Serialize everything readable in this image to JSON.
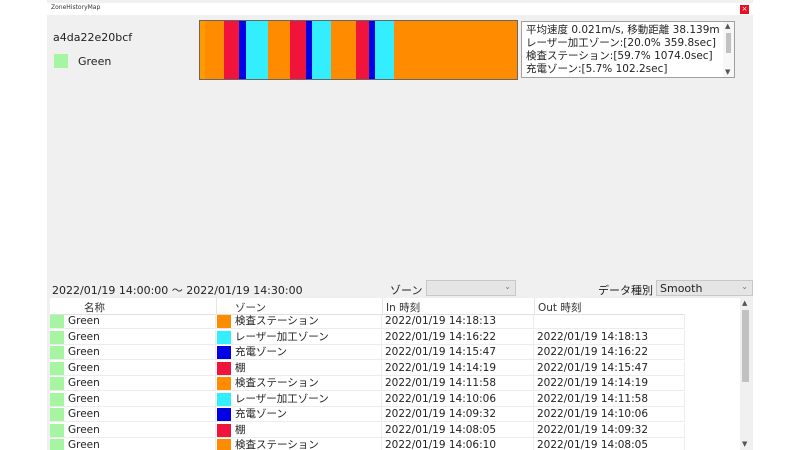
{
  "window": {
    "title": "ZoneHistoryMap",
    "close_glyph": "×"
  },
  "device": {
    "id": "a4da22e20bcf",
    "legend_label": "Green",
    "legend_color": "#a6f5a3"
  },
  "timeline": {
    "segments": [
      {
        "color": "#ff9900",
        "w": 1.5
      },
      {
        "color": "#ff8c00",
        "w": 6
      },
      {
        "color": "#f0143c",
        "w": 5
      },
      {
        "color": "#0000e6",
        "w": 2
      },
      {
        "color": "#33eeff",
        "w": 7
      },
      {
        "color": "#ff8c00",
        "w": 7
      },
      {
        "color": "#f0143c",
        "w": 5
      },
      {
        "color": "#0000e6",
        "w": 2
      },
      {
        "color": "#33eeff",
        "w": 6
      },
      {
        "color": "#ff8c00",
        "w": 8
      },
      {
        "color": "#f0143c",
        "w": 4
      },
      {
        "color": "#0000e6",
        "w": 2
      },
      {
        "color": "#33eeff",
        "w": 6
      },
      {
        "color": "#ff8c00",
        "w": 39
      }
    ]
  },
  "info": {
    "lines": [
      "平均速度 0.021m/s, 移動距離 38.139m",
      "レーザー加工ゾーン:[20.0% 359.8sec]",
      "検査ステーション:[59.7% 1074.0sec]",
      "充電ゾーン:[5.7% 102.2sec]"
    ],
    "scroll_up": "▲",
    "scroll_down": "▼"
  },
  "filter": {
    "time_range": "2022/01/19 14:00:00 ～ 2022/01/19 14:30:00",
    "zone_label": "ゾーン",
    "zone_value": "",
    "datatype_label": "データ種別",
    "datatype_value": "Smooth",
    "dropdown_glyph": "⌄"
  },
  "table": {
    "columns": [
      "名称",
      "ゾーン",
      "In 時刻",
      "Out 時刻"
    ],
    "rows": [
      {
        "name": "Green",
        "name_color": "#a6f5a3",
        "zone": "検査ステーション",
        "zone_color": "#ff8c00",
        "in": "2022/01/19 14:18:13",
        "out": ""
      },
      {
        "name": "Green",
        "name_color": "#a6f5a3",
        "zone": "レーザー加工ゾーン",
        "zone_color": "#33eeff",
        "in": "2022/01/19 14:16:22",
        "out": "2022/01/19 14:18:13"
      },
      {
        "name": "Green",
        "name_color": "#a6f5a3",
        "zone": "充電ゾーン",
        "zone_color": "#0000e6",
        "in": "2022/01/19 14:15:47",
        "out": "2022/01/19 14:16:22"
      },
      {
        "name": "Green",
        "name_color": "#a6f5a3",
        "zone": "棚",
        "zone_color": "#f0143c",
        "in": "2022/01/19 14:14:19",
        "out": "2022/01/19 14:15:47"
      },
      {
        "name": "Green",
        "name_color": "#a6f5a3",
        "zone": "検査ステーション",
        "zone_color": "#ff8c00",
        "in": "2022/01/19 14:11:58",
        "out": "2022/01/19 14:14:19"
      },
      {
        "name": "Green",
        "name_color": "#a6f5a3",
        "zone": "レーザー加工ゾーン",
        "zone_color": "#33eeff",
        "in": "2022/01/19 14:10:06",
        "out": "2022/01/19 14:11:58"
      },
      {
        "name": "Green",
        "name_color": "#a6f5a3",
        "zone": "充電ゾーン",
        "zone_color": "#0000e6",
        "in": "2022/01/19 14:09:32",
        "out": "2022/01/19 14:10:06"
      },
      {
        "name": "Green",
        "name_color": "#a6f5a3",
        "zone": "棚",
        "zone_color": "#f0143c",
        "in": "2022/01/19 14:08:05",
        "out": "2022/01/19 14:09:32"
      },
      {
        "name": "Green",
        "name_color": "#a6f5a3",
        "zone": "検査ステーション",
        "zone_color": "#ff8c00",
        "in": "2022/01/19 14:06:10",
        "out": "2022/01/19 14:08:05"
      }
    ],
    "scroll_up": "▲",
    "scroll_down": "▼"
  }
}
